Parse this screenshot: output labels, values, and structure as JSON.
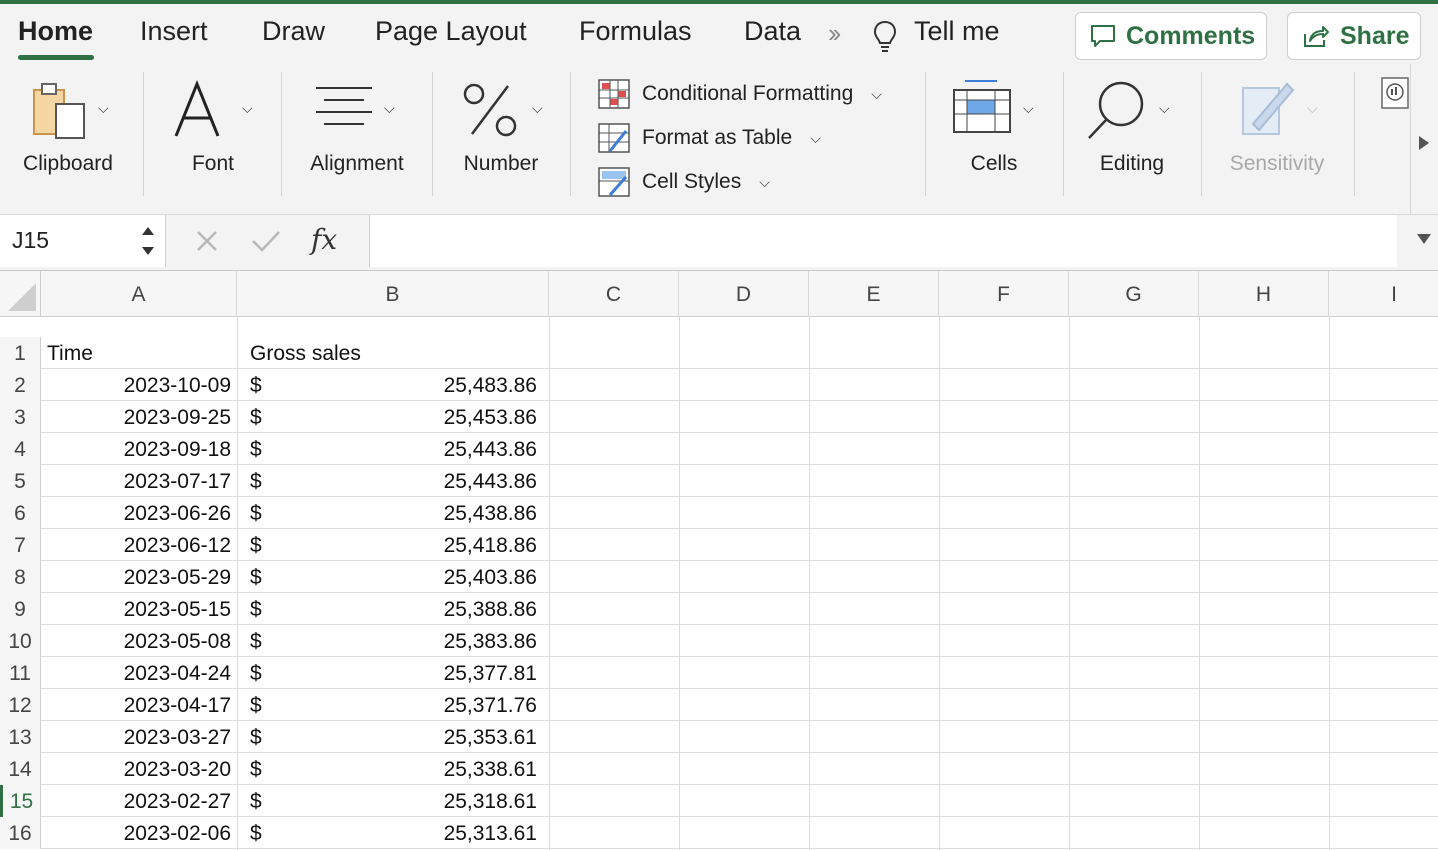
{
  "tabs": {
    "items": [
      "Home",
      "Insert",
      "Draw",
      "Page Layout",
      "Formulas",
      "Data"
    ],
    "active": "Home",
    "tell_me": "Tell me"
  },
  "buttons": {
    "comments": "Comments",
    "share": "Share"
  },
  "ribbon": {
    "clipboard": "Clipboard",
    "font": "Font",
    "alignment": "Alignment",
    "number": "Number",
    "conditional_formatting": "Conditional Formatting",
    "format_as_table": "Format as Table",
    "cell_styles": "Cell Styles",
    "cells": "Cells",
    "editing": "Editing",
    "sensitivity": "Sensitivity"
  },
  "formula_bar": {
    "name_box": "J15",
    "fx": "fx",
    "value": ""
  },
  "columns": [
    "A",
    "B",
    "C",
    "D",
    "E",
    "F",
    "G",
    "H",
    "I"
  ],
  "rows": [
    {
      "num": "1",
      "a": "Time",
      "b_sym": "",
      "b_val": "",
      "header": true
    },
    {
      "num": "2",
      "a": "2023-10-09",
      "b_sym": "$",
      "b_val": "25,483.86"
    },
    {
      "num": "3",
      "a": "2023-09-25",
      "b_sym": "$",
      "b_val": "25,453.86"
    },
    {
      "num": "4",
      "a": "2023-09-18",
      "b_sym": "$",
      "b_val": "25,443.86"
    },
    {
      "num": "5",
      "a": "2023-07-17",
      "b_sym": "$",
      "b_val": "25,443.86"
    },
    {
      "num": "6",
      "a": "2023-06-26",
      "b_sym": "$",
      "b_val": "25,438.86"
    },
    {
      "num": "7",
      "a": "2023-06-12",
      "b_sym": "$",
      "b_val": "25,418.86"
    },
    {
      "num": "8",
      "a": "2023-05-29",
      "b_sym": "$",
      "b_val": "25,403.86"
    },
    {
      "num": "9",
      "a": "2023-05-15",
      "b_sym": "$",
      "b_val": "25,388.86"
    },
    {
      "num": "10",
      "a": "2023-05-08",
      "b_sym": "$",
      "b_val": "25,383.86"
    },
    {
      "num": "11",
      "a": "2023-04-24",
      "b_sym": "$",
      "b_val": "25,377.81"
    },
    {
      "num": "12",
      "a": "2023-04-17",
      "b_sym": "$",
      "b_val": "25,371.76"
    },
    {
      "num": "13",
      "a": "2023-03-27",
      "b_sym": "$",
      "b_val": "25,353.61"
    },
    {
      "num": "14",
      "a": "2023-03-20",
      "b_sym": "$",
      "b_val": "25,338.61"
    },
    {
      "num": "15",
      "a": "2023-02-27",
      "b_sym": "$",
      "b_val": "25,318.61",
      "selected": true
    },
    {
      "num": "16",
      "a": "2023-02-06",
      "b_sym": "$",
      "b_val": "25,313.61"
    }
  ],
  "b1_header": "Gross sales",
  "colors": {
    "accent": "#2f7145",
    "ribbon_bg": "#f3f3f3",
    "grid_line": "#dcdcdc"
  }
}
